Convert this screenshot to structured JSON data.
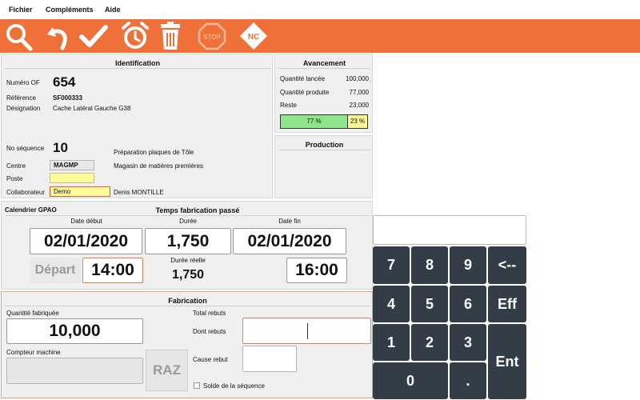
{
  "menu": {
    "file": "Fichier",
    "addons": "Compléments",
    "help": "Aide"
  },
  "colors": {
    "toolbar": "#f0703a",
    "accent_orange": "#e87c55",
    "green": "#8ee58c",
    "yellow": "#fff59a",
    "keypad": "#333d47"
  },
  "toolbar": {
    "icons": [
      "search-icon",
      "undo-icon",
      "check-icon",
      "alarm-clock-icon",
      "trash-icon",
      "stop-icon",
      "nc-icon"
    ],
    "stop_label": "STOP",
    "nc_label": "NC"
  },
  "identification": {
    "title": "Identification",
    "of_label": "Numéro OF",
    "of_value": "654",
    "ref_label": "Référence",
    "ref_value": "SF000333",
    "designation_label": "Désignation",
    "designation_value": "Cache Latéral Gauche G38",
    "seq_label": "No séquence",
    "seq_value": "10",
    "seq_desc": "Préparation plaques de Tôle",
    "centre_label": "Centre",
    "centre_value": "MAGMP",
    "centre_desc": "Magasin de matières premières",
    "poste_label": "Poste",
    "poste_value": "",
    "collab_label": "Collaborateur",
    "collab_value": "Demo",
    "collab_name": "Denis MONTILLE"
  },
  "avancement": {
    "title": "Avancement",
    "qty_launched_label": "Quantité lancée",
    "qty_launched": "100,000",
    "qty_produced_label": "Quantité produite",
    "qty_produced": "77,000",
    "remaining_label": "Reste",
    "remaining": "23,000",
    "progress_done": 0.77,
    "progress_done_label": "77 %",
    "progress_rest_label": "23 %"
  },
  "production": {
    "title": "Production"
  },
  "calendar": {
    "label": "Calendrier GPAO",
    "title": "Temps fabrication passé",
    "start_date_label": "Date début",
    "start_date": "02/01/2020",
    "duration_label": "Durée",
    "duration": "1,750",
    "end_date_label": "Date fin",
    "end_date": "02/01/2020",
    "start_button": "Départ",
    "start_time": "14:00",
    "real_duration_label": "Durée réelle",
    "real_duration": "1,750",
    "end_time": "16:00"
  },
  "fabrication": {
    "title": "Fabrication",
    "qty_label": "Quantité fabriquée",
    "qty_value": "10,000",
    "counter_label": "Compteur machine",
    "raz_button": "RAZ",
    "total_rejects_label": "Total rebuts",
    "of_which_rejects_label": "Dont rebuts",
    "reject_cause_label": "Cause rebut",
    "sequence_balance_label": "Solde de la séquence"
  },
  "keypad": {
    "k7": "7",
    "k8": "8",
    "k9": "9",
    "back": "<--",
    "k4": "4",
    "k5": "5",
    "k6": "6",
    "clear": "Eff",
    "k1": "1",
    "k2": "2",
    "k3": "3",
    "enter": "Ent",
    "k0": "0",
    "dot": "."
  }
}
